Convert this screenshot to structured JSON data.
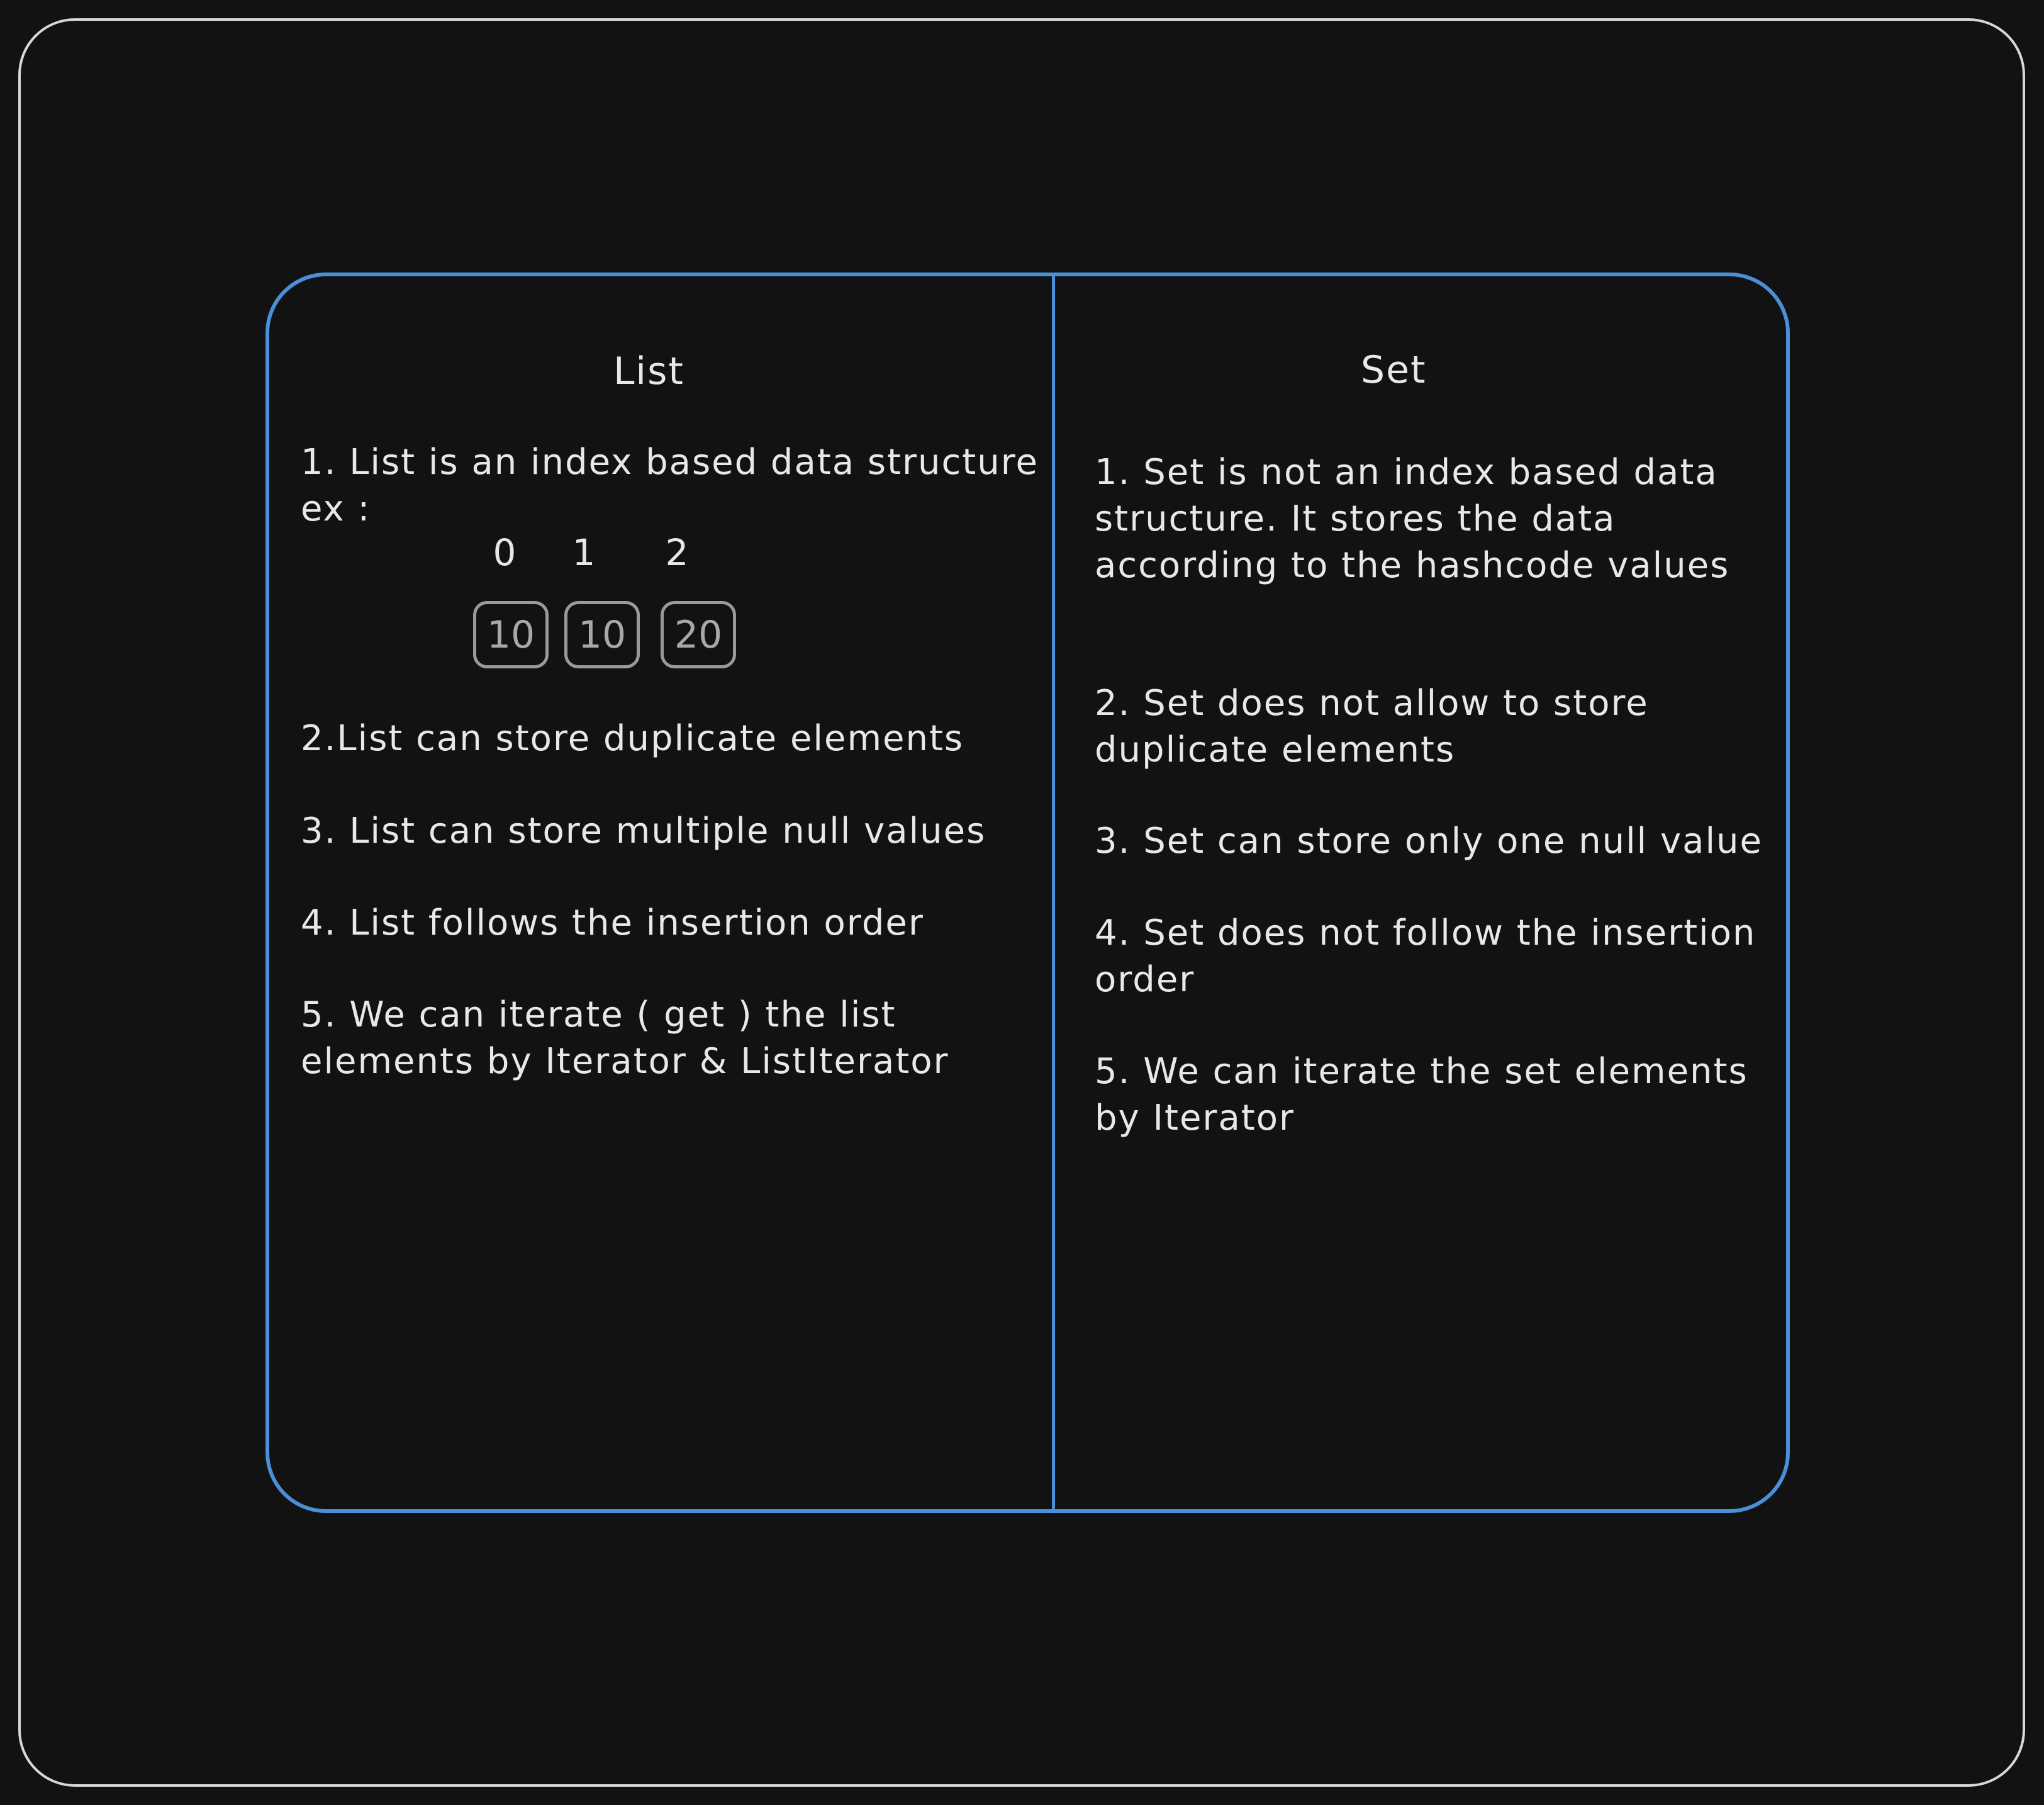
{
  "list": {
    "heading": "List",
    "point1_line1": "1. List is an index based data structure",
    "point1_line2": "ex :",
    "example": {
      "indices": [
        "0",
        "1",
        "2"
      ],
      "values": [
        "10",
        "10",
        "20"
      ]
    },
    "point2": "2.List can store duplicate elements",
    "point3": "3. List can store multiple null values",
    "point4": "4. List follows the insertion order",
    "point5_line1": "5. We can iterate ( get ) the list",
    "point5_line2": "elements by Iterator & ListIterator"
  },
  "set": {
    "heading": "Set",
    "point1_line1": "1. Set is not an index based data",
    "point1_line2": "structure. It stores the data",
    "point1_line3": "according to the hashcode values",
    "point2_line1": "2. Set does not allow to store",
    "point2_line2": "duplicate elements",
    "point3": "3. Set can store only one null value",
    "point4_line1": "4. Set does not follow the insertion",
    "point4_line2": "order",
    "point5_line1": "5. We can iterate the set elements",
    "point5_line2": "by Iterator"
  },
  "colors": {
    "background": "#121212",
    "frame_border": "#d8d8d8",
    "table_border": "#4a90d9",
    "text": "#e8e8e8",
    "cell_border": "#9a9a9a"
  }
}
